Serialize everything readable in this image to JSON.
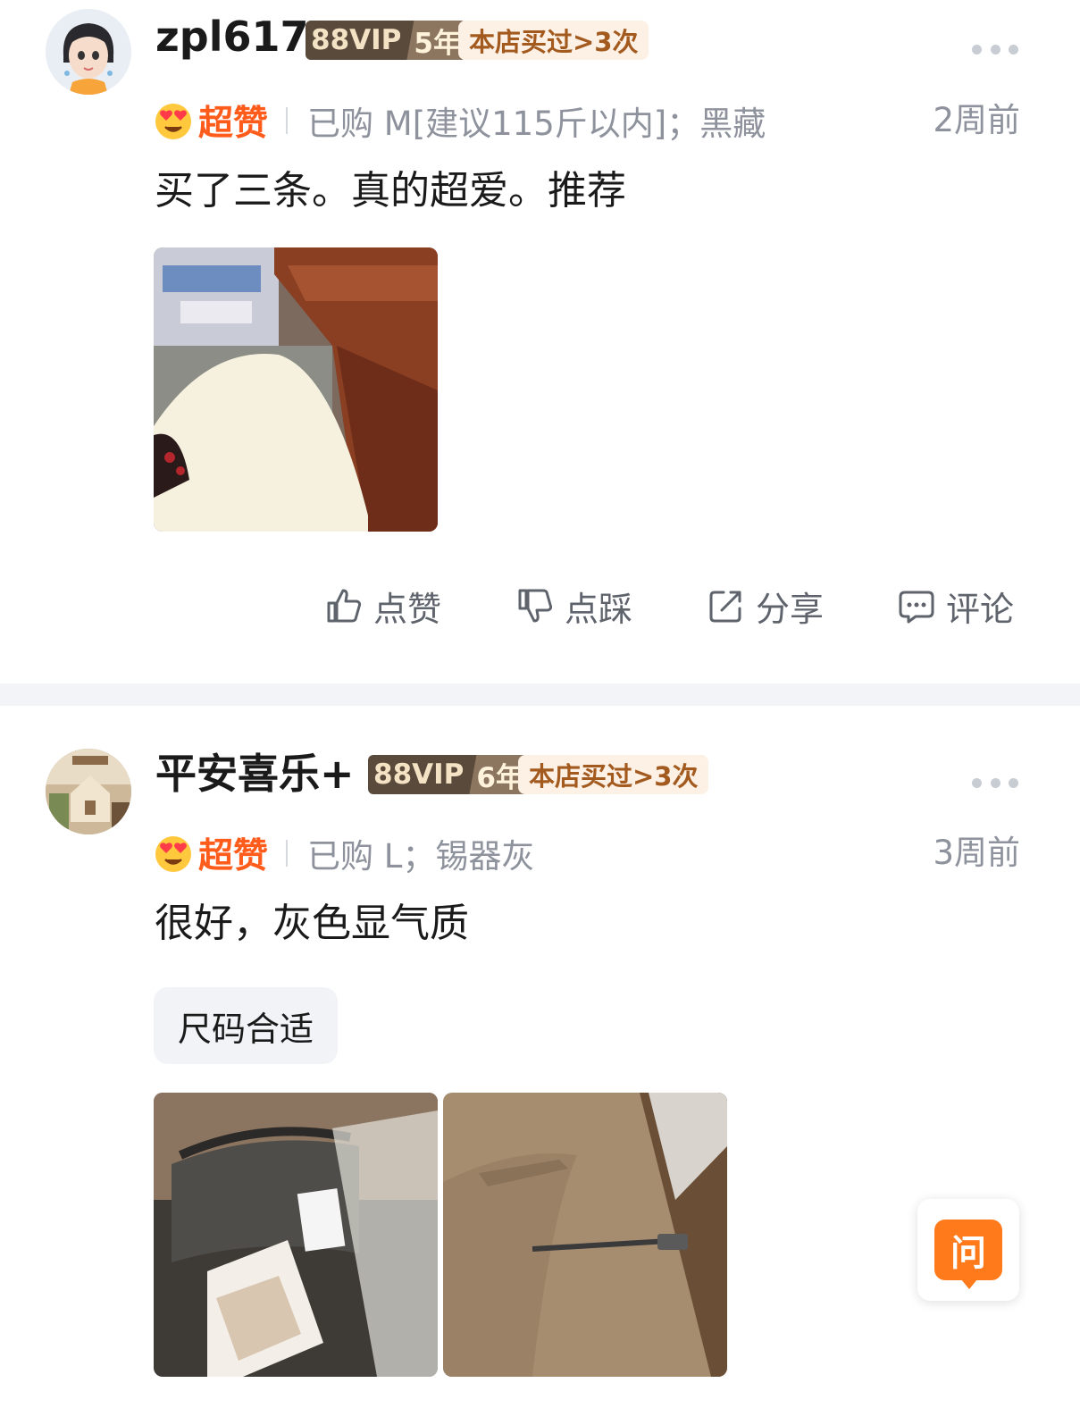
{
  "reviews": [
    {
      "username": "zpl617",
      "vip_label": "88VIP",
      "vip_years": "5年",
      "shop_badge": "本店买过>3次",
      "rating_label": "超赞",
      "purchase": "已购 M[建议115斤以内]；黑藏",
      "time": "2周前",
      "content": "买了三条。真的超爱。推荐",
      "photo_count": 1
    },
    {
      "username": "平安喜乐+",
      "vip_label": "88VIP",
      "vip_years": "6年",
      "shop_badge": "本店买过>3次",
      "rating_label": "超赞",
      "purchase": "已购 L；锡器灰",
      "time": "3周前",
      "content": "很好，灰色显气质",
      "tag": "尺码合适",
      "photo_count": 2
    }
  ],
  "actions": {
    "like": "点赞",
    "dislike": "点踩",
    "share": "分享",
    "comment": "评论"
  },
  "ask_button": "问",
  "colors": {
    "rating": "#ff5c1c",
    "vip_bg": "#5a4a3c",
    "shop_badge_bg": "#fdf0e4",
    "shop_badge_text": "#a35a1f",
    "divider": "#f3f4f7",
    "ask_button": "#ff7a1a"
  },
  "icons": [
    "more-icon",
    "heart-eyes-emoji-icon",
    "thumbs-up-icon",
    "thumbs-down-icon",
    "share-icon",
    "comment-icon"
  ]
}
